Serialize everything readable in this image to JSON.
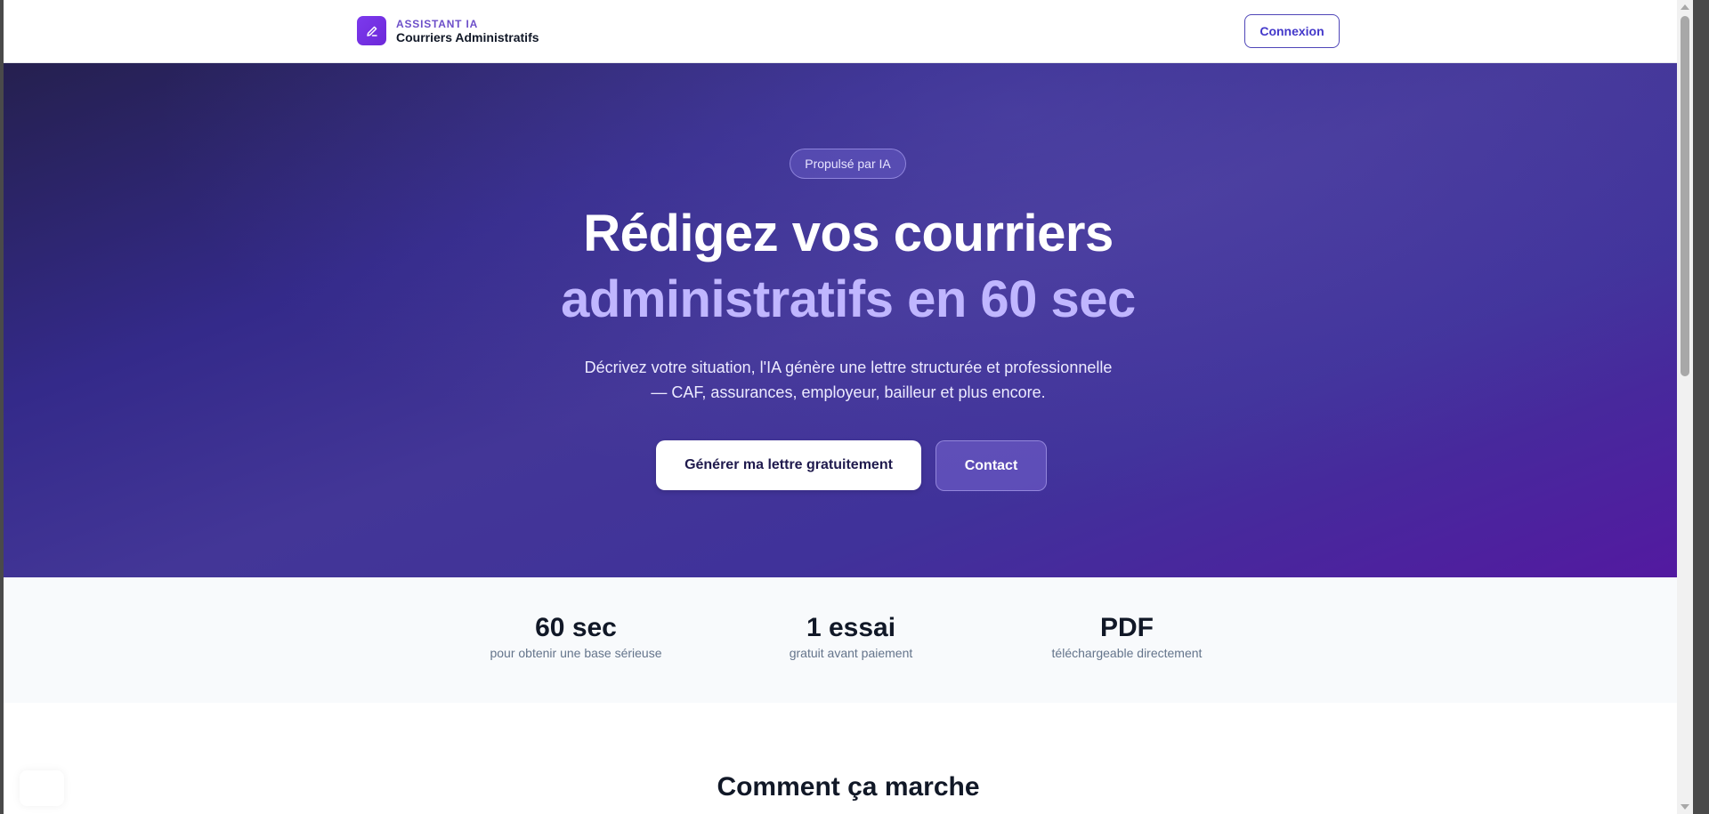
{
  "header": {
    "brand_kicker": "ASSISTANT IA",
    "brand_name": "Courriers Administratifs",
    "brand_icon": "pen-icon",
    "login_label": "Connexion"
  },
  "hero": {
    "badge": "Propulsé par IA",
    "title_line1": "Rédigez vos courriers",
    "title_line2": "administratifs en 60 sec",
    "subtitle": "Décrivez votre situation, l'IA génère une lettre structurée et professionnelle — CAF, assurances, employeur, bailleur et plus encore.",
    "primary_cta": "Générer ma lettre gratuitement",
    "secondary_cta": "Contact"
  },
  "stats": [
    {
      "value": "60 sec",
      "label": "pour obtenir une base sérieuse"
    },
    {
      "value": "1 essai",
      "label": "gratuit avant paiement"
    },
    {
      "value": "PDF",
      "label": "téléchargeable directement"
    }
  ],
  "how_it_works": {
    "title": "Comment ça marche"
  },
  "colors": {
    "brand": "#7c3aed",
    "hero_start": "#25204f",
    "hero_end": "#5319a0",
    "accent_text": "#c0b6ff",
    "login_border": "#4f46b8"
  }
}
